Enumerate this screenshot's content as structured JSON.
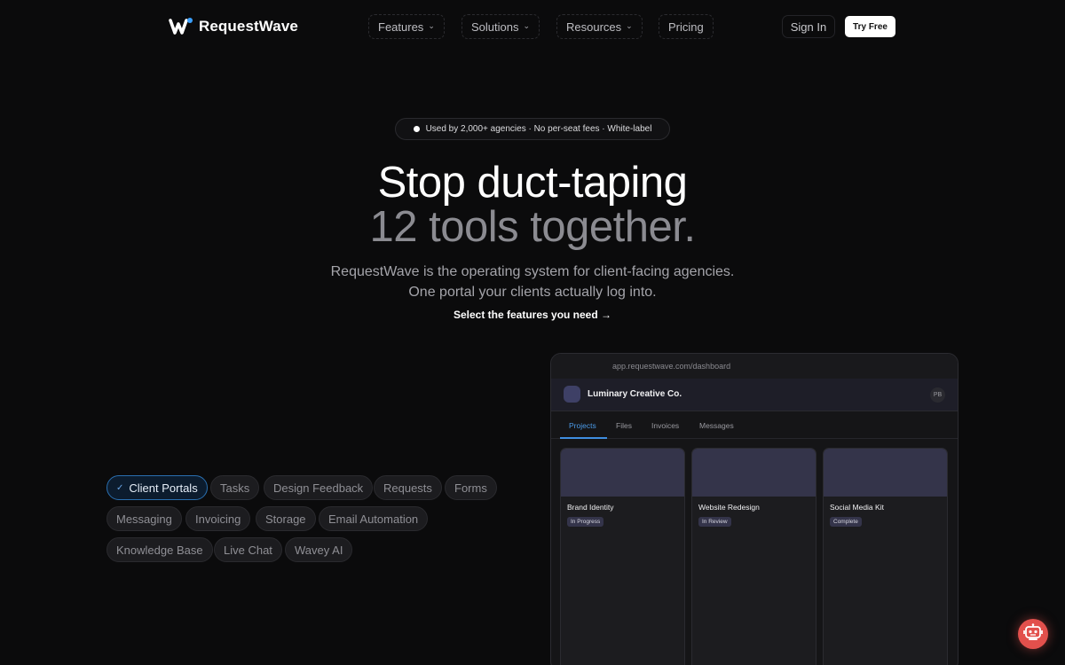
{
  "brand": {
    "name": "RequestWave",
    "accent": "#3aa0ff"
  },
  "nav": {
    "items": [
      {
        "label": "Features",
        "has_dropdown": true
      },
      {
        "label": "Solutions",
        "has_dropdown": true
      },
      {
        "label": "Resources",
        "has_dropdown": true
      },
      {
        "label": "Pricing",
        "has_dropdown": false
      }
    ],
    "sign_in": "Sign In",
    "try_free": "Try Free"
  },
  "hero": {
    "badge": "Used by 2,000+ agencies · No per-seat fees · White-label",
    "title_line1": "Stop duct-taping",
    "title_line2": "12 tools together.",
    "subtitle_line1": "RequestWave is the operating system for client-facing agencies.",
    "subtitle_line2": "One portal your clients actually log into.",
    "cta": "Select the features you need →"
  },
  "features": {
    "chips": [
      {
        "label": "Client Portals",
        "selected": true
      },
      {
        "label": "Tasks",
        "selected": false
      },
      {
        "label": "Design Feedback",
        "selected": false
      },
      {
        "label": "Requests",
        "selected": false
      },
      {
        "label": "Forms",
        "selected": false
      },
      {
        "label": "Messaging",
        "selected": false
      },
      {
        "label": "Invoicing",
        "selected": false
      },
      {
        "label": "Storage",
        "selected": false
      },
      {
        "label": "Email Automation",
        "selected": false
      },
      {
        "label": "Knowledge Base",
        "selected": false
      },
      {
        "label": "Live Chat",
        "selected": false
      },
      {
        "label": "Wavey AI",
        "selected": false
      }
    ]
  },
  "dashboard": {
    "url": "app.requestwave.com/dashboard",
    "company": "Luminary Creative Co.",
    "user_initials": "PB",
    "tabs": [
      "Projects",
      "Files",
      "Invoices",
      "Messages"
    ],
    "active_tab": "Projects",
    "projects": [
      {
        "title": "Brand Identity",
        "status": "In Progress"
      },
      {
        "title": "Website Redesign",
        "status": "In Review"
      },
      {
        "title": "Social Media Kit",
        "status": "Complete"
      }
    ]
  },
  "assistant": {
    "icon": "robot-icon",
    "color": "#e2504c"
  }
}
